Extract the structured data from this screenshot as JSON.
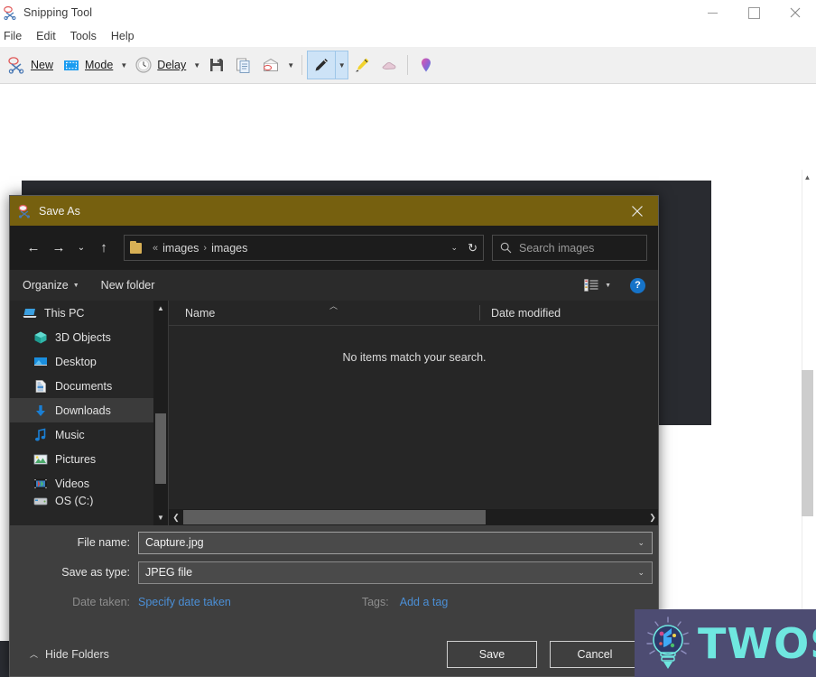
{
  "app": {
    "title": "Snipping Tool",
    "icon": "scissors-icon",
    "window_controls": {
      "minimize": "minimize-icon",
      "maximize": "maximize-icon",
      "close": "close-icon"
    },
    "menu": [
      "File",
      "Edit",
      "Tools",
      "Help"
    ],
    "toolbar": {
      "new_label": "New",
      "mode_label": "Mode",
      "delay_label": "Delay",
      "items": [
        {
          "name": "new-button",
          "label": "New",
          "icon": "scissors-icon"
        },
        {
          "name": "mode-button",
          "label": "Mode",
          "icon": "selection-rectangle-icon",
          "has_caret": true
        },
        {
          "name": "delay-button",
          "label": "Delay",
          "icon": "clock-icon",
          "has_caret": true
        },
        {
          "name": "save-button",
          "label": "",
          "icon": "floppy-disk-icon"
        },
        {
          "name": "copy-button",
          "label": "",
          "icon": "copy-pages-icon"
        },
        {
          "name": "email-button",
          "label": "",
          "icon": "envelope-icon",
          "has_caret": true
        },
        {
          "name": "pen-button",
          "label": "",
          "icon": "pen-icon",
          "has_caret": true,
          "selected": true
        },
        {
          "name": "highlighter-button",
          "label": "",
          "icon": "highlighter-icon"
        },
        {
          "name": "eraser-button",
          "label": "",
          "icon": "eraser-icon"
        },
        {
          "name": "editor-button",
          "label": "",
          "icon": "paint-3d-bulb-icon"
        }
      ]
    }
  },
  "dialog": {
    "title": "Save As",
    "title_icon": "snipping-tool-icon",
    "close_icon": "close-icon",
    "nav": {
      "back": "back-arrow-icon",
      "forward": "forward-arrow-icon",
      "recent": "chevron-down-icon",
      "up": "up-arrow-icon",
      "refresh": "refresh-icon",
      "breadcrumb_prefix": "«",
      "breadcrumb": [
        "images",
        "images"
      ],
      "breadcrumb_separator": "›",
      "folder_icon": "folder-icon"
    },
    "search": {
      "placeholder": "Search images",
      "icon": "search-icon"
    },
    "commands": {
      "organize": "Organize",
      "new_folder": "New folder",
      "view_icon": "view-list-icon",
      "help_icon": "help-icon",
      "help_label": "?"
    },
    "tree": [
      {
        "label": "This PC",
        "icon": "this-pc-icon",
        "selected": false,
        "root": true
      },
      {
        "label": "3D Objects",
        "icon": "3d-objects-icon",
        "selected": false
      },
      {
        "label": "Desktop",
        "icon": "desktop-icon",
        "selected": false
      },
      {
        "label": "Documents",
        "icon": "documents-icon",
        "selected": false
      },
      {
        "label": "Downloads",
        "icon": "downloads-icon",
        "selected": true
      },
      {
        "label": "Music",
        "icon": "music-icon",
        "selected": false
      },
      {
        "label": "Videos",
        "icon": "videos-icon",
        "selected": false
      },
      {
        "label": "Pictures",
        "icon": "pictures-icon",
        "selected": false
      },
      {
        "label": "OS (C:)",
        "icon": "drive-icon",
        "selected": false
      }
    ],
    "list": {
      "columns": [
        "Name",
        "Date modified"
      ],
      "sort_indicator": "chevron-up-icon",
      "empty_message": "No items match your search.",
      "rows": []
    },
    "fields": {
      "file_name_label": "File name:",
      "file_name_value": "Capture.jpg",
      "save_as_type_label": "Save as type:",
      "save_as_type_value": "JPEG file",
      "date_taken_label": "Date taken:",
      "date_taken_link": "Specify date taken",
      "tags_label": "Tags:",
      "tags_link": "Add a tag"
    },
    "footer": {
      "hide_folders": "Hide Folders",
      "hide_folders_icon": "chevron-up-icon",
      "save": "Save",
      "cancel": "Cancel"
    }
  },
  "watermark": {
    "text": "TWOS",
    "icon": "lightbulb-icon",
    "bg_color": "#4d4c72",
    "text_color": "#6fe7e0"
  },
  "colors": {
    "dialog_title_bg": "#76600f",
    "dialog_bg": "#373737",
    "dialog_list_bg": "#262626",
    "accent_link": "#4b8fd6",
    "selection_blue": "#cde3f7",
    "canvas_image": "#292b30"
  }
}
